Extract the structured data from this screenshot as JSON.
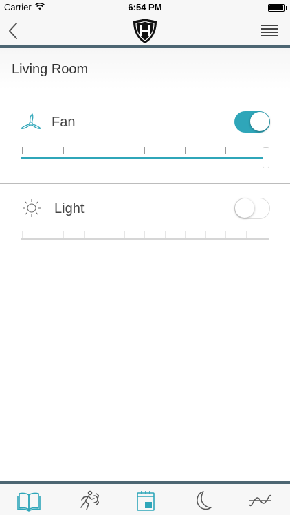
{
  "status_bar": {
    "carrier": "Carrier",
    "time": "6:54 PM"
  },
  "nav": {
    "back_icon": "chevron-left-icon",
    "logo_icon": "shield-h-logo",
    "menu_icon": "hamburger-menu-icon"
  },
  "room": {
    "title": "Living Room"
  },
  "devices": [
    {
      "label": "Fan",
      "icon": "fan-icon",
      "toggle_on": true,
      "level": 1.0
    },
    {
      "label": "Light",
      "icon": "sun-icon",
      "toggle_on": false,
      "level": 0.0
    }
  ],
  "tabs": [
    {
      "icon": "book-icon",
      "active": true
    },
    {
      "icon": "running-person-icon",
      "active": false
    },
    {
      "icon": "calendar-icon",
      "active": true
    },
    {
      "icon": "moon-icon",
      "active": false
    },
    {
      "icon": "sine-wave-icon",
      "active": false
    }
  ],
  "colors": {
    "accent": "#2fa6b9",
    "bar_rule": "#4d6673",
    "bar_background": "#f7f7f7"
  }
}
